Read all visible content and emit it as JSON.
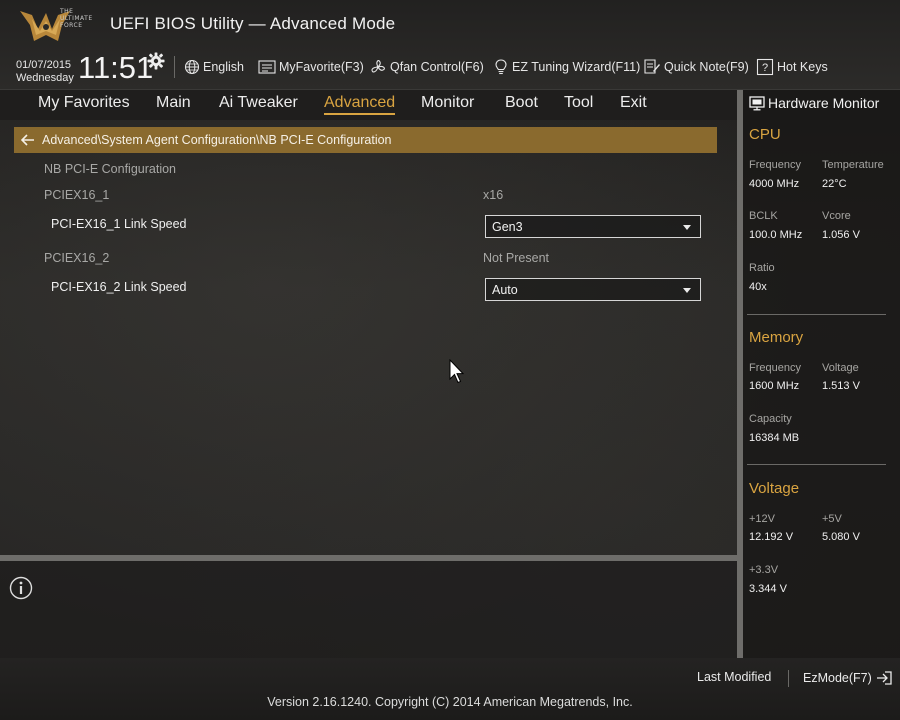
{
  "header": {
    "logo_text_lines": [
      "THE",
      "ULTIMATE",
      "FORCE"
    ],
    "title": "UEFI BIOS Utility — Advanced Mode",
    "date": "01/07/2015",
    "weekday": "Wednesday",
    "time": "11:51",
    "settings_icon": "gear-icon",
    "toolbar": [
      {
        "label": "English",
        "icon": "globe-icon"
      },
      {
        "label": "MyFavorite(F3)",
        "icon": "favorite-list-icon"
      },
      {
        "label": "Qfan Control(F6)",
        "icon": "fan-icon"
      },
      {
        "label": "EZ Tuning Wizard(F11)",
        "icon": "bulb-icon"
      },
      {
        "label": "Quick Note(F9)",
        "icon": "note-icon"
      },
      {
        "label": "Hot Keys",
        "icon": "question-icon"
      }
    ]
  },
  "menu": {
    "tabs": [
      {
        "label": "My Favorites"
      },
      {
        "label": "Main"
      },
      {
        "label": "Ai Tweaker"
      },
      {
        "label": "Advanced",
        "active": true
      },
      {
        "label": "Monitor"
      },
      {
        "label": "Boot"
      },
      {
        "label": "Tool"
      },
      {
        "label": "Exit"
      }
    ]
  },
  "breadcrumb": {
    "path": "Advanced\\System Agent Configuration\\NB PCI-E Configuration",
    "icon": "back-arrow-icon"
  },
  "content": {
    "section_title": "NB PCI-E Configuration",
    "slot1": {
      "label": "PCIEX16_1",
      "value": "x16"
    },
    "slot1_speed": {
      "label": "PCI-EX16_1 Link Speed",
      "selected": "Gen3"
    },
    "slot2": {
      "label": "PCIEX16_2",
      "value": "Not Present"
    },
    "slot2_speed": {
      "label": "PCI-EX16_2 Link Speed",
      "selected": "Auto"
    }
  },
  "help": {
    "icon": "info-icon"
  },
  "hardware_monitor": {
    "title": "Hardware Monitor",
    "icon": "monitor-icon",
    "cpu": {
      "title": "CPU",
      "frequency_label": "Frequency",
      "frequency": "4000 MHz",
      "temperature_label": "Temperature",
      "temperature": "22°C",
      "bclk_label": "BCLK",
      "bclk": "100.0 MHz",
      "vcore_label": "Vcore",
      "vcore": "1.056 V",
      "ratio_label": "Ratio",
      "ratio": "40x"
    },
    "memory": {
      "title": "Memory",
      "frequency_label": "Frequency",
      "frequency": "1600 MHz",
      "voltage_label": "Voltage",
      "voltage": "1.513 V",
      "capacity_label": "Capacity",
      "capacity": "16384 MB"
    },
    "voltage": {
      "title": "Voltage",
      "v12_label": "+12V",
      "v12": "12.192 V",
      "v5_label": "+5V",
      "v5": "5.080 V",
      "v33_label": "+3.3V",
      "v33": "3.344 V"
    }
  },
  "footer": {
    "last_modified": "Last Modified",
    "ezmode": "EzMode(F7)",
    "ezmode_icon": "exit-arrow-icon",
    "version": "Version 2.16.1240. Copyright (C) 2014 American Megatrends, Inc."
  },
  "colors": {
    "accent": "#d9a441",
    "breadcrumb_bg": "#8a6a2e",
    "background": "#262524"
  }
}
